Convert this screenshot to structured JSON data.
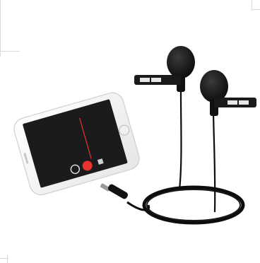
{
  "image": {
    "subject": "smartphone-with-dual-lavalier-microphones",
    "background_color": "#ffffff",
    "phone_color": "#f5f5f5",
    "screen_color": "#1b1b1d",
    "record_button_color": "#e8332f",
    "mic_color": "#111111"
  }
}
